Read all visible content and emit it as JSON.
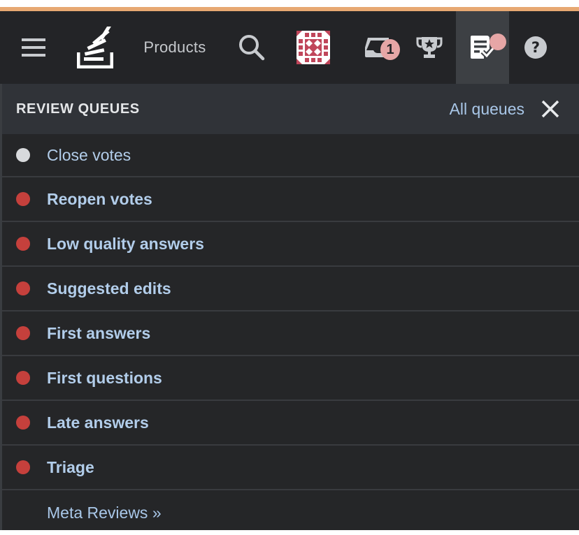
{
  "topbar": {
    "menu_icon": "hamburger-menu-icon",
    "logo_icon": "stack-overflow-logo-icon",
    "products_label": "Products",
    "search_icon": "search-icon",
    "avatar_icon": "user-avatar-identicon",
    "inbox_icon": "inbox-icon",
    "inbox_count": "1",
    "achievements_icon": "trophy-icon",
    "review_icon": "review-queue-icon",
    "help_icon": "help-icon",
    "colors": {
      "accent": "#e7a872",
      "bar_bg": "#232427",
      "badge": "#e6a6a6",
      "avatar": "#c0465a"
    }
  },
  "panel": {
    "title": "REVIEW QUEUES",
    "all_queues_label": "All queues",
    "close_icon": "close-icon",
    "queues": [
      {
        "label": "Close votes",
        "status": "idle"
      },
      {
        "label": "Reopen votes",
        "status": "active"
      },
      {
        "label": "Low quality answers",
        "status": "active"
      },
      {
        "label": "Suggested edits",
        "status": "active"
      },
      {
        "label": "First answers",
        "status": "active"
      },
      {
        "label": "First questions",
        "status": "active"
      },
      {
        "label": "Late answers",
        "status": "active"
      },
      {
        "label": "Triage",
        "status": "active"
      }
    ],
    "meta_reviews_label": "Meta Reviews »",
    "colors": {
      "active_dot": "#c5403c",
      "idle_dot": "#d8dadd",
      "link": "#b2cdea"
    }
  }
}
